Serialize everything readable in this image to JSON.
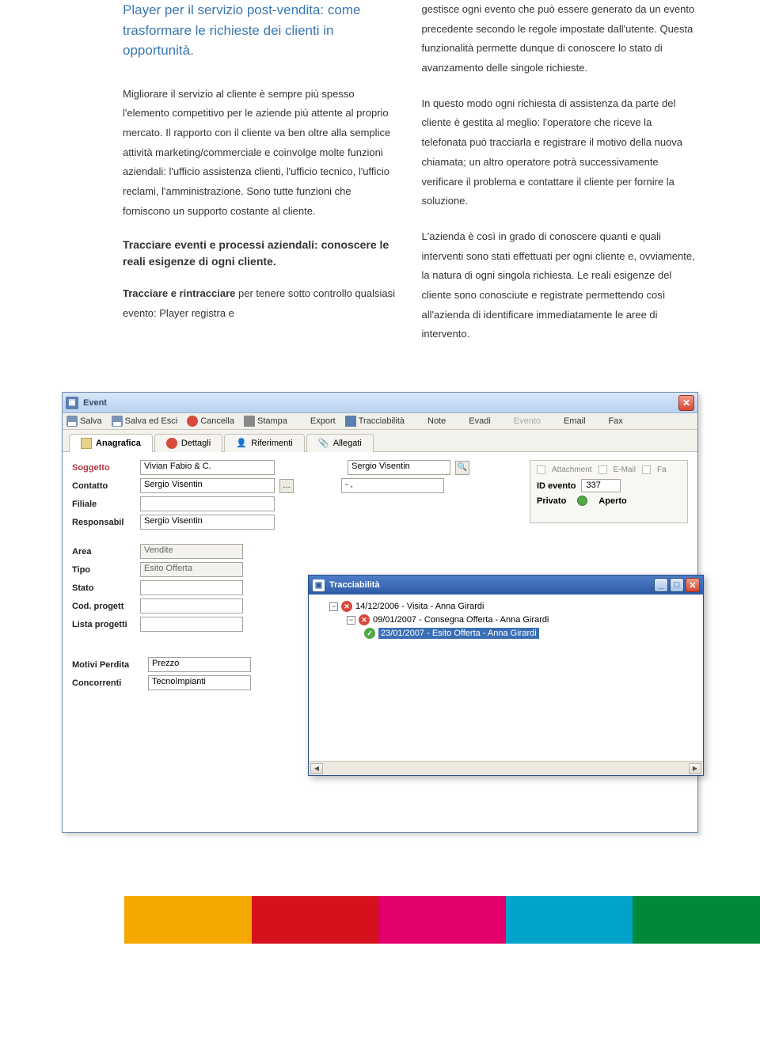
{
  "headline": "Player per il servizio post-vendita: come trasformare le richieste dei clienti in opportunità.",
  "col1_p1": "Migliorare il servizio al cliente è sempre più spesso l'elemento competitivo per le aziende più attente al proprio mercato.",
  "col1_p2": "Il rapporto con il cliente va ben oltre alla semplice attività marketing/commerciale e coinvolge molte funzioni aziendali: l'ufficio assistenza clienti, l'ufficio tecnico, l'ufficio reclami, l'amministrazione.",
  "col1_p3": "Sono tutte funzioni che forniscono un supporto costante al cliente.",
  "col1_sub": "Tracciare eventi e processi aziendali: conoscere le reali esigenze di ogni cliente.",
  "col1_p4_bold": "Tracciare e rintracciare",
  "col1_p4_rest": " per tenere sotto controllo qualsiasi evento: Player registra e",
  "col2_p1": "gestisce ogni evento che può essere generato da un evento precedente secondo le regole impostate dall'utente. Questa funzionalità permette dunque di conoscere lo stato di avanzamento delle singole richieste.",
  "col2_p2": "In questo modo ogni richiesta di assistenza da parte del cliente è gestita al meglio: l'operatore che riceve la telefonata può tracciarla e registrare il motivo della nuova chiamata; un altro operatore potrà successivamente verificare il problema e contattare il cliente per fornire la soluzione.",
  "col2_p3": "L'azienda è così in grado di conoscere quanti e quali interventi sono stati effettuati per ogni cliente e, ovviamente, la natura di ogni singola richiesta. Le reali esigenze del cliente sono conosciute e registrate permettendo così all'azienda di identificare immediatamente le aree di intervento.",
  "app": {
    "window_title": "Event",
    "toolbar": {
      "salva": "Salva",
      "salva_esci": "Salva ed Esci",
      "cancella": "Cancella",
      "stampa": "Stampa",
      "export": "Export",
      "tracciabilita": "Tracciabilità",
      "note": "Note",
      "evadi": "Evadi",
      "evento": "Evento",
      "email": "Email",
      "fax": "Fax"
    },
    "tabs": {
      "anagrafica": "Anagrafica",
      "dettagli": "Dettagli",
      "riferimenti": "Riferimenti",
      "allegati": "Allegati"
    },
    "form": {
      "soggetto_label": "Soggetto",
      "soggetto_value": "Vivian Fabio & C.",
      "contatto_label": "Contatto",
      "contatto_value": "Sergio Visentin",
      "filiale_label": "Filiale",
      "filiale_value": "",
      "responsabil_label": "Responsabil",
      "responsabil_value": "Sergio Visentin",
      "right_value": "Sergio Visentin",
      "dash_value": "- ,",
      "area_label": "Area",
      "area_value": "Vendite",
      "tipo_label": "Tipo",
      "tipo_value": "Esito Offerta",
      "stato_label": "Stato",
      "stato_value": "",
      "cod_label": "Cod. progett",
      "cod_value": "",
      "lista_label": "Lista progetti",
      "lista_value": "",
      "motivi_label": "Motivi Perdita",
      "motivi_value": "Prezzo",
      "concorrenti_label": "Concorrenti",
      "concorrenti_value": "TecnoImpianti"
    },
    "side": {
      "attachment": "Attachment",
      "email": "E-Mail",
      "fa": "Fa",
      "id_label": "ID evento",
      "id_value": "337",
      "privato": "Privato",
      "aperto": "Aperto"
    },
    "popup": {
      "title": "Tracciabilità",
      "node1": "14/12/2006 - Visita - Anna Girardi",
      "node2": "09/01/2007 - Consegna Offerta - Anna Girardi",
      "node3": "23/01/2007 - Esito Offerta - Anna Girardi"
    }
  }
}
